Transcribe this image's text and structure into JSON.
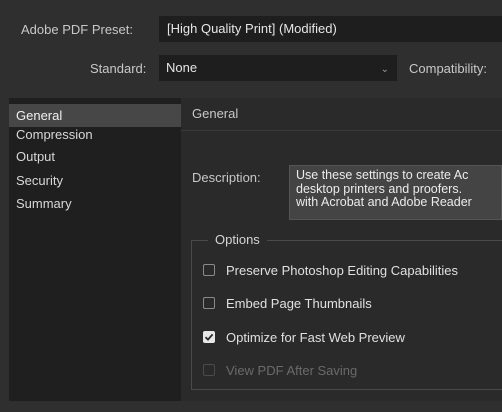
{
  "preset": {
    "label": "Adobe PDF Preset:",
    "value": "[High Quality Print] (Modified)"
  },
  "standard": {
    "label": "Standard:",
    "value": "None",
    "compat_label": "Compatibility:"
  },
  "sidebar": {
    "items": [
      {
        "label": "General",
        "selected": true
      },
      {
        "label": "Compression"
      },
      {
        "label": "Output"
      },
      {
        "label": "Security"
      },
      {
        "label": "Summary"
      }
    ]
  },
  "panel": {
    "title": "General",
    "description_label": "Description:",
    "description_text": "Use these settings to create Ac\ndesktop printers and proofers.\nwith Acrobat and Adobe Reader"
  },
  "options": {
    "title": "Options",
    "items": [
      {
        "label": "Preserve Photoshop Editing Capabilities",
        "checked": false,
        "enabled": true
      },
      {
        "label": "Embed Page Thumbnails",
        "checked": false,
        "enabled": true
      },
      {
        "label": "Optimize for Fast Web Preview",
        "checked": true,
        "enabled": true
      },
      {
        "label": "View PDF After Saving",
        "checked": false,
        "enabled": false
      }
    ]
  }
}
